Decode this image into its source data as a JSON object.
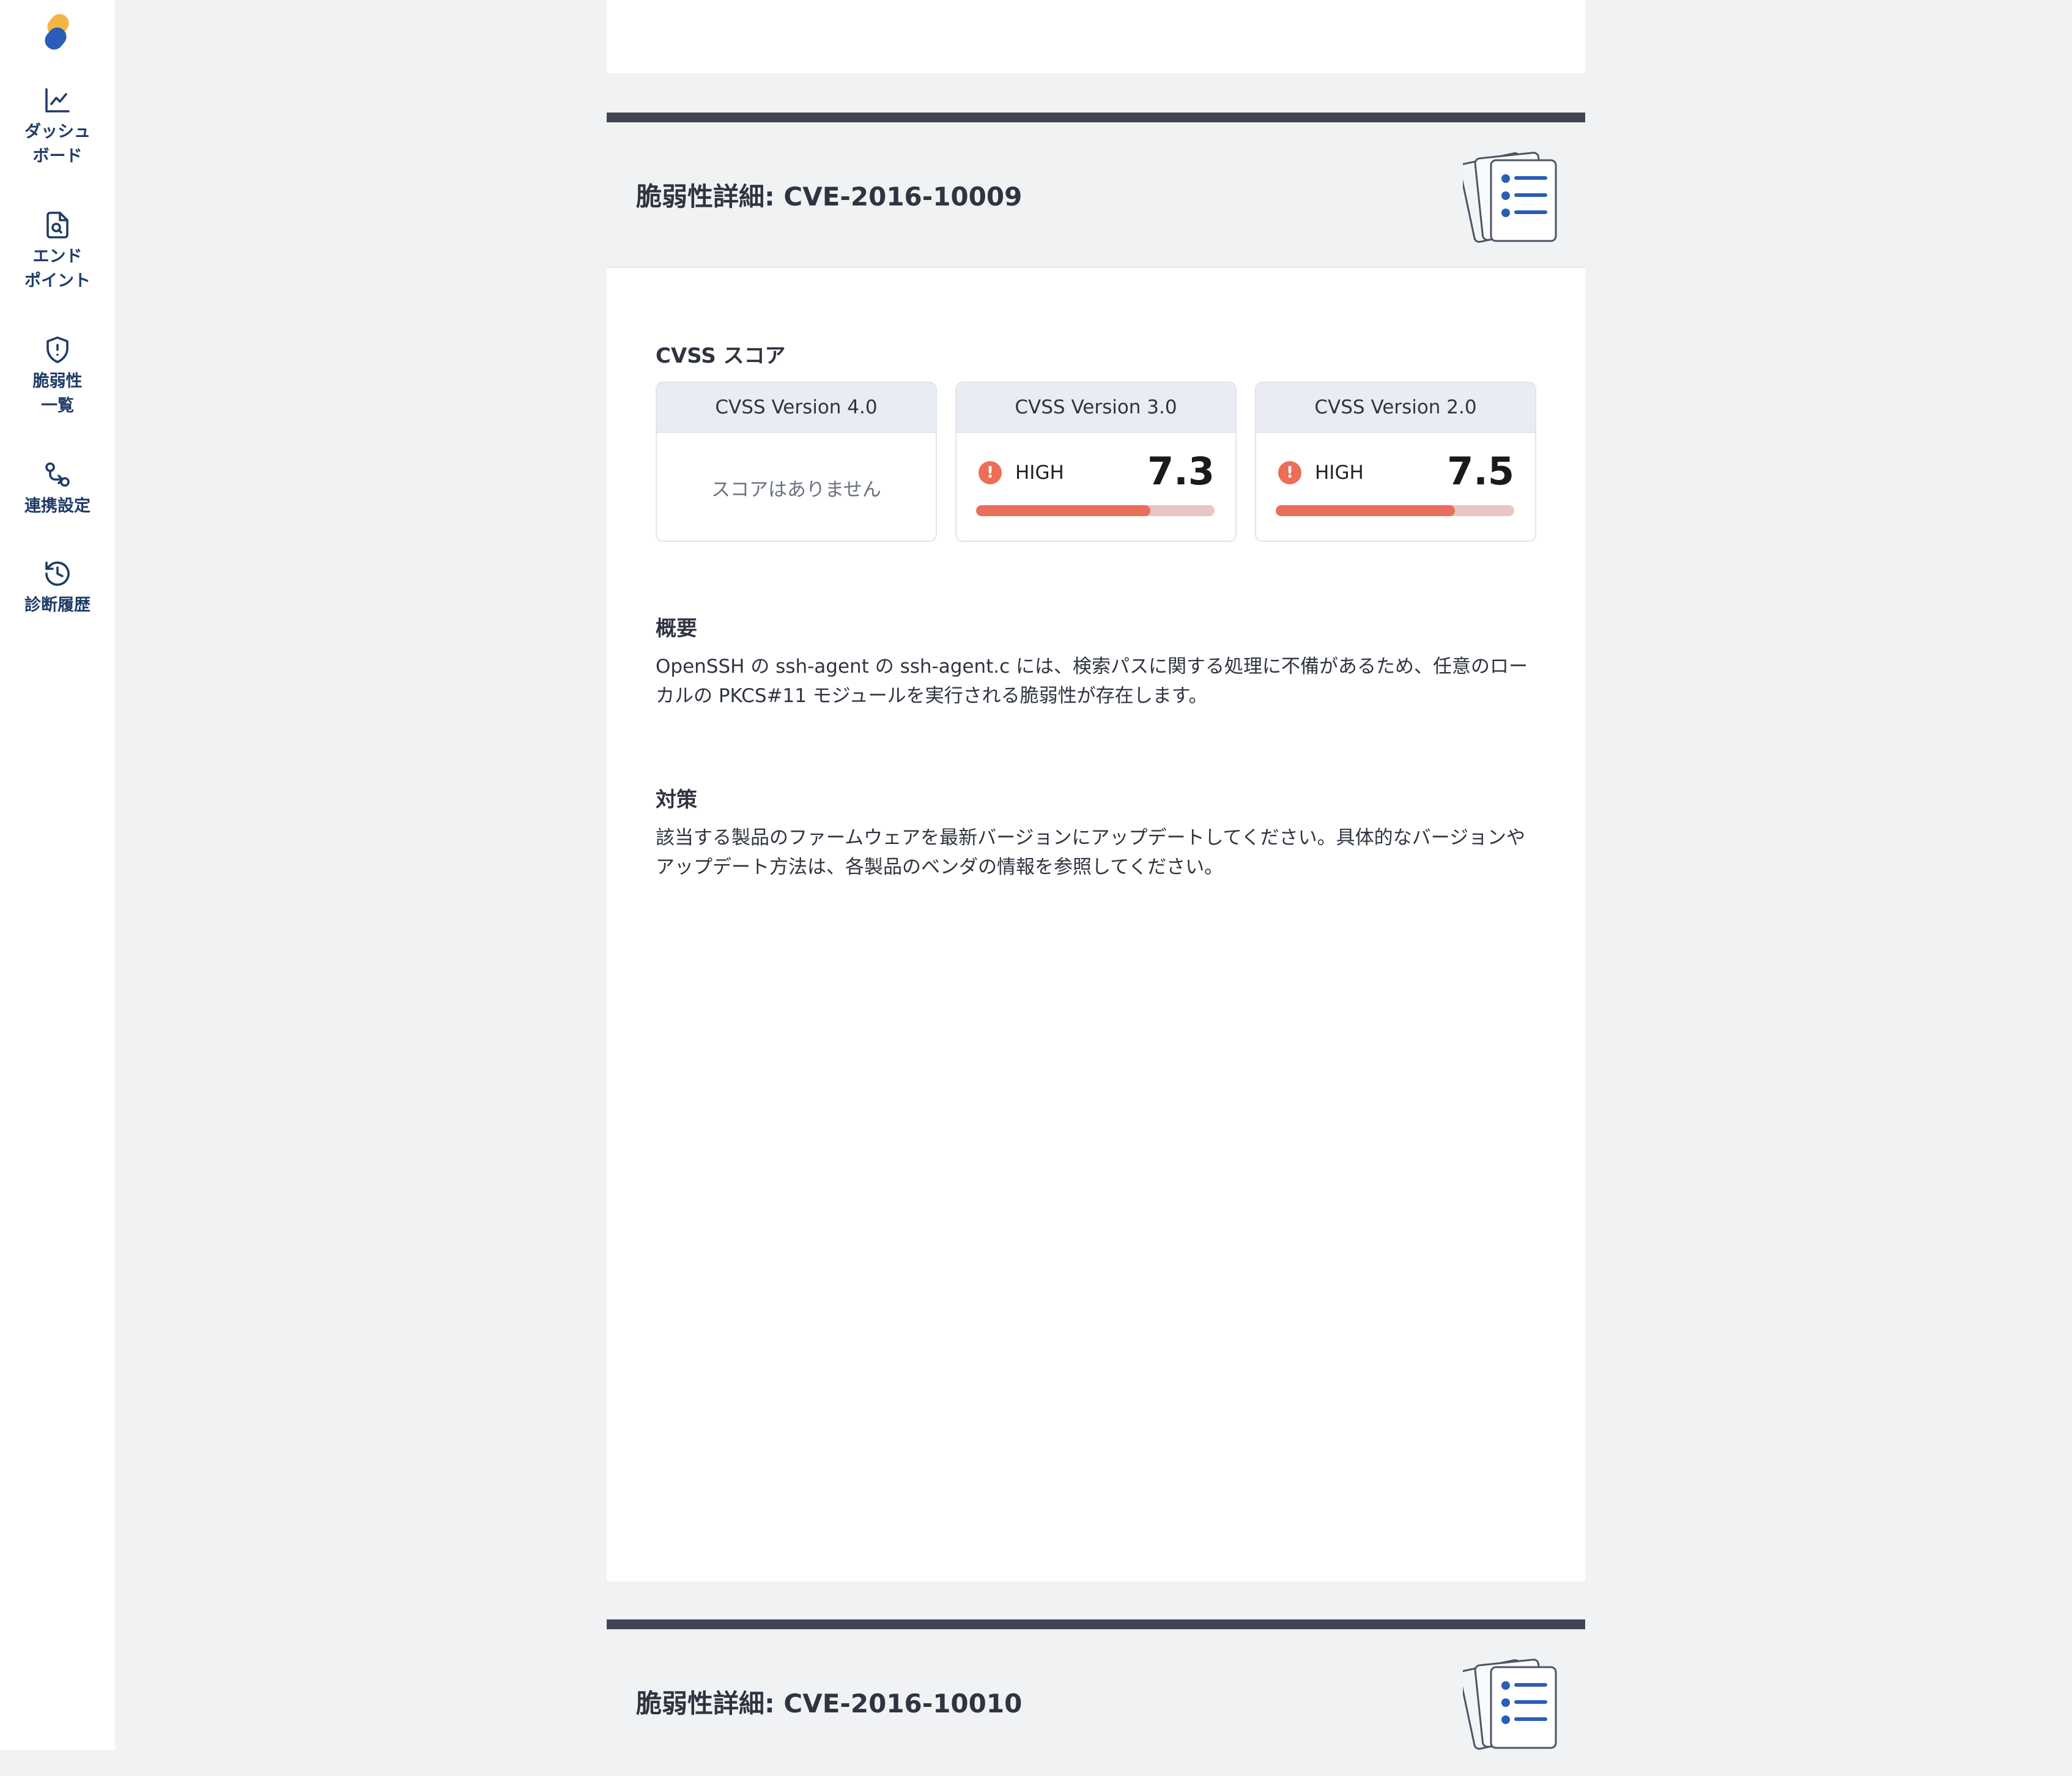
{
  "sidebar": {
    "items": [
      {
        "label": "ダッシュ\nボード",
        "icon": "chart-line-icon"
      },
      {
        "label": "エンド\nポイント",
        "icon": "file-search-icon"
      },
      {
        "label": "脆弱性\n一覧",
        "icon": "shield-alert-icon"
      },
      {
        "label": "連携設定",
        "icon": "git-compare-icon"
      },
      {
        "label": "診断履歴",
        "icon": "history-icon"
      }
    ]
  },
  "sections": [
    {
      "title": "脆弱性詳細: CVE-2016-10009",
      "cvss_heading": "CVSS スコア",
      "scores": [
        {
          "version": "CVSS Version 4.0",
          "empty_text": "スコアはありません"
        },
        {
          "version": "CVSS Version 3.0",
          "severity": "HIGH",
          "score": "7.3",
          "level": 0.73
        },
        {
          "version": "CVSS Version 2.0",
          "severity": "HIGH",
          "score": "7.5",
          "level": 0.75
        }
      ],
      "summary_heading": "概要",
      "summary_text": "OpenSSH の ssh-agent の ssh-agent.c には、検索パスに関する処理に不備があるため、任意のローカルの PKCS#11 モジュールを実行される脆弱性が存在します。",
      "countermeasure_heading": "対策",
      "countermeasure_text": "該当する製品のファームウェアを最新バージョンにアップデートしてください。具体的なバージョンやアップデート方法は、各製品のベンダの情報を参照してください。"
    },
    {
      "title": "脆弱性詳細: CVE-2016-10010"
    }
  ],
  "colors": {
    "accent_navy": "#1f3b67",
    "severity_high": "#ea6f5b",
    "severity_track": "#e9c5c3",
    "section_bar": "#404553"
  }
}
